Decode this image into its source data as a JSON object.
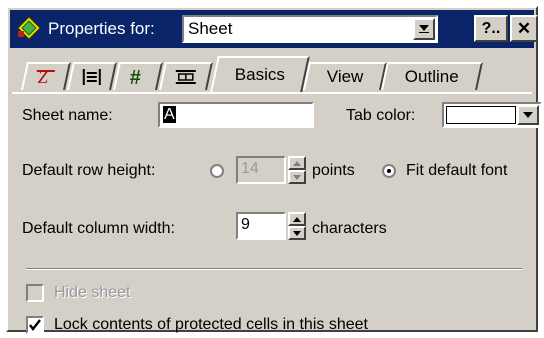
{
  "title": {
    "label": "Properties for:",
    "selected": "Sheet"
  },
  "buttons": {
    "help": "?..",
    "close": "✕"
  },
  "tabs": [
    {
      "label": "",
      "icon": "font-icon"
    },
    {
      "label": "",
      "icon": "align-icon"
    },
    {
      "label": "",
      "icon": "number-icon"
    },
    {
      "label": "",
      "icon": "border-icon"
    },
    {
      "label": "Basics",
      "active": true
    },
    {
      "label": "View"
    },
    {
      "label": "Outline"
    }
  ],
  "basics": {
    "sheet_name_label": "Sheet name:",
    "sheet_name_value": "A",
    "tab_color_label": "Tab color:",
    "row_height_label": "Default row height:",
    "row_height_value": "14",
    "row_height_units": "points",
    "fit_font_label": "Fit default font",
    "fit_font_selected": true,
    "col_width_label": "Default column width:",
    "col_width_value": "9",
    "col_width_units": "characters",
    "hide_sheet_label": "Hide sheet",
    "hide_sheet_checked": false,
    "lock_label": "Lock contents of protected cells in this sheet",
    "lock_checked": true
  },
  "colors": {
    "titlebar": "#0a246a",
    "dialog": "#d4d0c8"
  }
}
